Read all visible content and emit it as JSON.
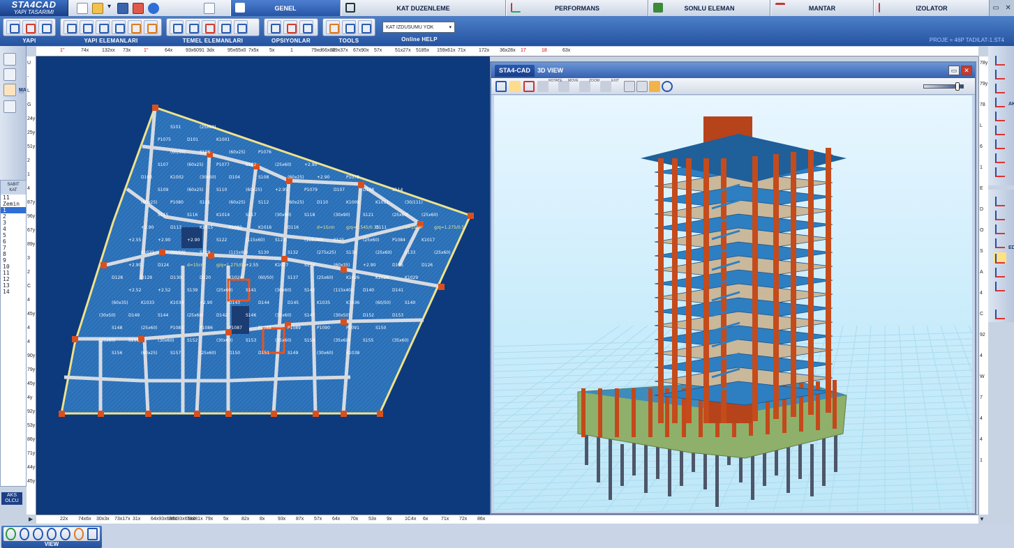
{
  "app": {
    "logo_main": "STA4CAD",
    "logo_sub": "YAPI TASARIMI"
  },
  "tabs": [
    {
      "label": "GENEL",
      "active": true
    },
    {
      "label": "KAT DUZENLEME"
    },
    {
      "label": "PERFORMANS"
    },
    {
      "label": "SONLU ELEMAN"
    },
    {
      "label": "MANTAR"
    },
    {
      "label": "IZOLATOR"
    }
  ],
  "ribbon": {
    "groups": [
      {
        "label": "YAPI"
      },
      {
        "label": "YAPI ELEMANLARI"
      },
      {
        "label": "TEMEL ELEMANLARI"
      },
      {
        "label": "OPSIYONLAR"
      },
      {
        "label": "TOOLS"
      },
      {
        "label": "Online HELP"
      }
    ],
    "kat_select": "KAT IZDUSUMU YOK",
    "loads_label": "LOADS"
  },
  "project": "PROJE = 46P TADILAT-1.ST4",
  "left_panel": {
    "makro": "MAKRO",
    "kat_header_1": "SABIT",
    "kat_header_2": "KAT",
    "floors": [
      "11",
      "Zemin",
      "1",
      "2",
      "3",
      "4",
      "5",
      "6",
      "7",
      "8",
      "9",
      "10",
      "11",
      "12",
      "13",
      "14"
    ],
    "selected_floor_index": 2,
    "aks_olcu_1": "AKS",
    "aks_olcu_2": "OLCU"
  },
  "right_panel": {
    "aks": "AKS",
    "edit": "EDIT"
  },
  "window_3d": {
    "tab": "STA4-CAD",
    "title": "3D VIEW",
    "tool_labels": [
      "ROTATE",
      "MOVE",
      "ZOOM",
      "EXIT"
    ]
  },
  "view_group": {
    "label": "VIEW",
    "icon_labels": [
      "ALL",
      "WIN",
      "IN",
      "OUT"
    ]
  },
  "ruler_top": [
    "1''",
    "74x",
    "132xx",
    "73x",
    "1''",
    "64x",
    "93x6091",
    "3dx",
    "95x65x0",
    "7x5x",
    "5x",
    "1",
    "79xd66x82",
    "89x37x",
    "67x90x",
    "57x",
    "51x27x",
    "5185x",
    "159x61x",
    "71x",
    "172x",
    "36x28x",
    "17",
    "18",
    "63x"
  ],
  "ruler_bottom": [
    "22x",
    "74x6x",
    "30x3x",
    "73x17x",
    "31x",
    "64x93x6091",
    "3dx93x65x0",
    "78x81x",
    "79x",
    "5x",
    "82x",
    "8x",
    "93x",
    "87x",
    "57x",
    "64x",
    "70x",
    "53x",
    "9x",
    "1C4x",
    "6x",
    "71x",
    "72x",
    "86x"
  ],
  "ruler_left": [
    "U",
    "-",
    "L",
    "G",
    "24y",
    "25y",
    "51y",
    "2",
    "1",
    "4",
    "87y",
    "96y",
    "67y",
    "89y",
    "3",
    "2",
    "C",
    "4",
    "45y",
    "4",
    "4",
    "90y",
    "79y",
    "45y",
    "4y",
    "92y",
    "53y",
    "86y",
    "71y",
    "44y",
    "45y"
  ],
  "ruler_right": [
    "78y",
    "79y",
    "78",
    "L",
    "6",
    "1",
    "E",
    "D",
    "O",
    "S",
    "A",
    "4",
    "C",
    "92",
    "4",
    "W",
    "7",
    "4",
    "4",
    "1"
  ],
  "plan_labels": [
    "S101",
    "(25x60)",
    "P1075",
    "D101",
    "K1001",
    "(60/50)",
    "S106",
    "(60x25)",
    "P1076",
    "S107",
    "(60x25)",
    "P1077",
    "S102",
    "(25x60)",
    "+2.90",
    "D103",
    "K1002",
    "(30x60)",
    "D104",
    "S108",
    "(60x25)",
    "+2.90",
    "P1078",
    "S109",
    "(60x25)",
    "S110",
    "(60x25)",
    "+2.95",
    "P1079",
    "D107",
    "D108",
    "S114",
    "(60x25)",
    "P1080",
    "S111",
    "(60x25)",
    "S112",
    "(60x25)",
    "D110",
    "K1008",
    "K1011",
    "(30/111)",
    "S115",
    "S116",
    "K1014",
    "S117",
    "(30x90)",
    "S118",
    "(30x90)",
    "S121",
    "(25x60)",
    "(25x60)",
    "+2.90",
    "D113",
    "K1015",
    "P1082",
    "K1016",
    "D116",
    "d=15cm",
    "g/q=0.545/0.35",
    "D111",
    "d=15cm",
    "g/q=1.275/0.5",
    "+2.55",
    "+2.90",
    "+2.90",
    "S122",
    "(115x60)",
    "S123",
    "(115x60)",
    "S125",
    "(25x60)",
    "P1084",
    "K1017",
    "K1021",
    "(60/50)",
    "S129",
    "(115x60)",
    "S130",
    "S132",
    "(275x25)",
    "S135",
    "(25x60)",
    "S133",
    "(25x60)",
    "+2.90",
    "D124",
    "d=15cm",
    "g/q=1.275/0.5",
    "+2.55",
    "K1027",
    "S134",
    "(60x35)",
    "+2.90",
    "D125",
    "D126",
    "D128",
    "D129",
    "D130",
    "D120",
    "K1024",
    "(60/50)",
    "S137",
    "(25x60)",
    "K1026",
    "K1028",
    "K1029",
    "+2.52",
    "+2.52",
    "S139",
    "(25x60)",
    "S141",
    "(30x60)",
    "S142",
    "(115x40)",
    "D140",
    "D141",
    "(60x35)",
    "K1033",
    "K1034",
    "+2.90",
    "D143",
    "D144",
    "D145",
    "K1035",
    "K1036",
    "(60/50)",
    "S140",
    "(30x50)",
    "D149",
    "S144",
    "(25x60)",
    "D142",
    "S146",
    "(35x60)",
    "S147",
    "(30x50)",
    "D152",
    "D153",
    "S148",
    "(25x60)",
    "P1085",
    "P1086",
    "P1087",
    "P1088",
    "P1089",
    "P1090",
    "P1091",
    "S150",
    "(25x60)",
    "S151",
    "(30x60)",
    "S152",
    "(30x60)",
    "S153",
    "(35x60)",
    "S154",
    "(35x60)",
    "S155",
    "(35x60)",
    "S156",
    "(60x25)",
    "S157",
    "(25x60)",
    "D150",
    "D151",
    "S149",
    "(30x60)",
    "K1038"
  ]
}
